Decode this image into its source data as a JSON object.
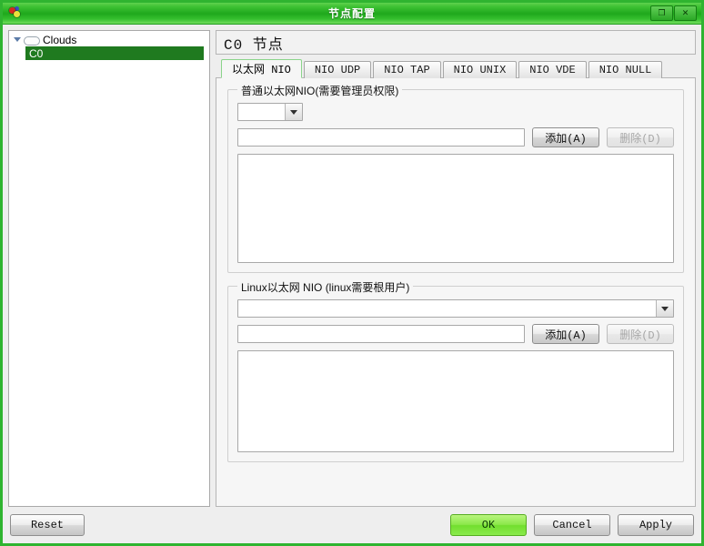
{
  "window": {
    "title": "节点配置",
    "icon": "node-config-icon",
    "controls": [
      {
        "name": "maximize-button",
        "glyph": "❐"
      },
      {
        "name": "close-button",
        "glyph": "✕"
      }
    ],
    "accent_color": "#2fb430",
    "title_gradient_top": "#5fd24e",
    "title_gradient_bottom": "#72dd5c"
  },
  "tree": {
    "root": {
      "label": "Clouds",
      "icon": "cloud-icon",
      "expanded": true
    },
    "children": [
      {
        "label": "C0",
        "selected": true,
        "selection_color": "#1f7a1f"
      }
    ]
  },
  "page": {
    "title": "C0 节点"
  },
  "tabs": [
    {
      "label": "以太网 NIO",
      "active": true
    },
    {
      "label": "NIO UDP",
      "active": false
    },
    {
      "label": "NIO TAP",
      "active": false
    },
    {
      "label": "NIO UNIX",
      "active": false
    },
    {
      "label": "NIO VDE",
      "active": false
    },
    {
      "label": "NIO NULL",
      "active": false
    }
  ],
  "groups": [
    {
      "legend": "普通以太网NIO(需要管理员权限)",
      "combo": {
        "value": "",
        "placeholder": ""
      },
      "textfield": {
        "value": "",
        "placeholder": ""
      },
      "add_button": {
        "label": "添加(A)",
        "mnemonic": "A",
        "enabled": true
      },
      "delete_button": {
        "label": "删除(D)",
        "mnemonic": "D",
        "enabled": false
      },
      "list_items": []
    },
    {
      "legend": "Linux以太网 NIO (linux需要根用户)",
      "combo": {
        "value": "",
        "placeholder": ""
      },
      "textfield": {
        "value": "",
        "placeholder": ""
      },
      "add_button": {
        "label": "添加(A)",
        "mnemonic": "A",
        "enabled": true
      },
      "delete_button": {
        "label": "删除(D)",
        "mnemonic": "D",
        "enabled": false
      },
      "list_items": []
    }
  ],
  "footer": {
    "reset_label": "Reset",
    "ok_label": "OK",
    "cancel_label": "Cancel",
    "apply_label": "Apply",
    "ok_color": "#8be84a"
  }
}
